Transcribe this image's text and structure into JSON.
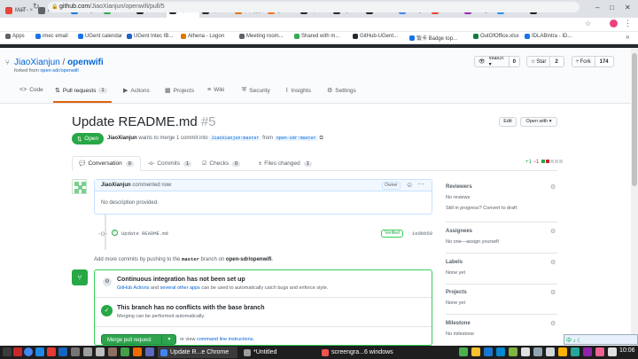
{
  "browser": {
    "tabs": [
      {
        "label": "Mail -",
        "color": "#ea4335"
      },
      {
        "label": "Resou",
        "color": "#5f6368"
      },
      {
        "label": "Badge",
        "color": "#1a73e8"
      },
      {
        "label": "Funde",
        "color": "#34a853"
      },
      {
        "label": "How T",
        "color": "#202124"
      },
      {
        "label": "Upc",
        "color": "#24292e",
        "active": true
      },
      {
        "label": "openc",
        "color": "#24292e"
      },
      {
        "label": "图飞机",
        "color": "#e37400"
      },
      {
        "label": "gitlat",
        "color": "#fc6d26"
      },
      {
        "label": "Upd",
        "color": "#24292e"
      },
      {
        "label": "Synci",
        "color": "#24292e"
      },
      {
        "label": "How t",
        "color": "#202124"
      },
      {
        "label": "Googl",
        "color": "#4285f4"
      },
      {
        "label": "Mail -",
        "color": "#ea4335"
      },
      {
        "label": "Xiang",
        "color": "#9c27b0"
      },
      {
        "label": "Elem",
        "color": "#2196f3"
      },
      {
        "label": "How t",
        "color": "#202124"
      }
    ],
    "new_tab": "+",
    "window_controls": [
      "–",
      "□",
      "✕"
    ],
    "url_host": "github.com",
    "url_path": "/JiaoXianjun/openwifi/pull/5",
    "bookmarks": [
      {
        "label": "Apps",
        "color": "#5f6368"
      },
      {
        "label": "imec email",
        "color": "#1a73e8"
      },
      {
        "label": "UGent calendar",
        "color": "#1a73e8"
      },
      {
        "label": "UGent Intec IB...",
        "color": "#1e64c8"
      },
      {
        "label": "Athena - Logon",
        "color": "#e37400"
      },
      {
        "label": "Meeting room...",
        "color": "#5f6368"
      },
      {
        "label": "Shared with m...",
        "color": "#34a853"
      },
      {
        "label": "GitHub-UGent...",
        "color": "#24292e"
      },
      {
        "label": "饭卡 Badge top...",
        "color": "#1a73e8"
      },
      {
        "label": "OutOfOffice.xlsx",
        "color": "#107c41"
      },
      {
        "label": "IDLABintra - ID...",
        "color": "#1a73e8"
      }
    ],
    "more_bookmarks": "»"
  },
  "repo": {
    "owner": "JiaoXianjun",
    "separator": "/",
    "name": "openwifi",
    "forked_prefix": "forked from",
    "forked_from": "open-sdr/openwifi",
    "watch_label": "Watch ▾",
    "watch_count": "0",
    "star_label": "Star",
    "star_count": "2",
    "fork_label": "Fork",
    "fork_count": "174",
    "tabs": [
      {
        "label": "Code",
        "icon": "<>"
      },
      {
        "label": "Pull requests",
        "icon": "⇅",
        "count": "1"
      },
      {
        "label": "Actions",
        "icon": "▶"
      },
      {
        "label": "Projects",
        "icon": "▦"
      },
      {
        "label": "Wiki",
        "icon": "≡"
      },
      {
        "label": "Security",
        "icon": "⛨"
      },
      {
        "label": "Insights",
        "icon": "⌇"
      },
      {
        "label": "Settings",
        "icon": "⚙"
      }
    ]
  },
  "pr": {
    "title": "Update README.md",
    "number": "#5",
    "edit_label": "Edit",
    "open_with_label": "Open with ▾",
    "status": "Open",
    "author": "JiaoXianjun",
    "meta_text": "wants to merge 1 commit into",
    "base_branch": "JiaoXianjun:master",
    "from_text": "from",
    "head_branch": "open-sdr:master",
    "tabs": [
      {
        "label": "Conversation",
        "count": "0"
      },
      {
        "label": "Commits",
        "count": "1"
      },
      {
        "label": "Checks",
        "count": "0"
      },
      {
        "label": "Files changed",
        "count": "1"
      }
    ],
    "diff_add": "+1",
    "diff_del": "−1"
  },
  "comment": {
    "author": "JiaoXianjun",
    "when": "commented now",
    "badge": "Owner",
    "body": "No description provided."
  },
  "commit": {
    "message": "Update README.md",
    "verified": "Verified",
    "sha": "1e0bb50"
  },
  "add_more": {
    "prefix": "Add more commits by pushing to the",
    "branch": "master",
    "middle": "branch on",
    "repo": "open-sdr/openwifi",
    "suffix": "."
  },
  "merge": {
    "ci_title": "Continuous integration has not been set up",
    "ci_link1": "GitHub Actions",
    "ci_and": "and",
    "ci_link2": "several other apps",
    "ci_rest": "can be used to automatically catch bugs and enforce style.",
    "ok_title": "This branch has no conflicts with the base branch",
    "ok_sub": "Merging can be performed automatically.",
    "button": "Merge pull request",
    "caret": "▾",
    "or_view": "or view",
    "cmd_link": "command line instructions",
    "cmd_end": "."
  },
  "sidebar": {
    "reviewers_title": "Reviewers",
    "reviewers_value": "No reviews",
    "reviewers_draft": "Still in progress? Convert to draft",
    "assignees_title": "Assignees",
    "assignees_value": "No one—assign yourself",
    "labels_title": "Labels",
    "labels_value": "None yet",
    "projects_title": "Projects",
    "projects_value": "None yet",
    "milestone_title": "Milestone",
    "milestone_value": "No milestone"
  },
  "taskbar": {
    "windows": [
      {
        "label": "Update R...e Chrome",
        "active": true
      },
      {
        "label": "*Untitled"
      },
      {
        "label": "screengra...6 windows"
      }
    ],
    "clock": "10:06",
    "tray": "中 ♪ ☾"
  }
}
